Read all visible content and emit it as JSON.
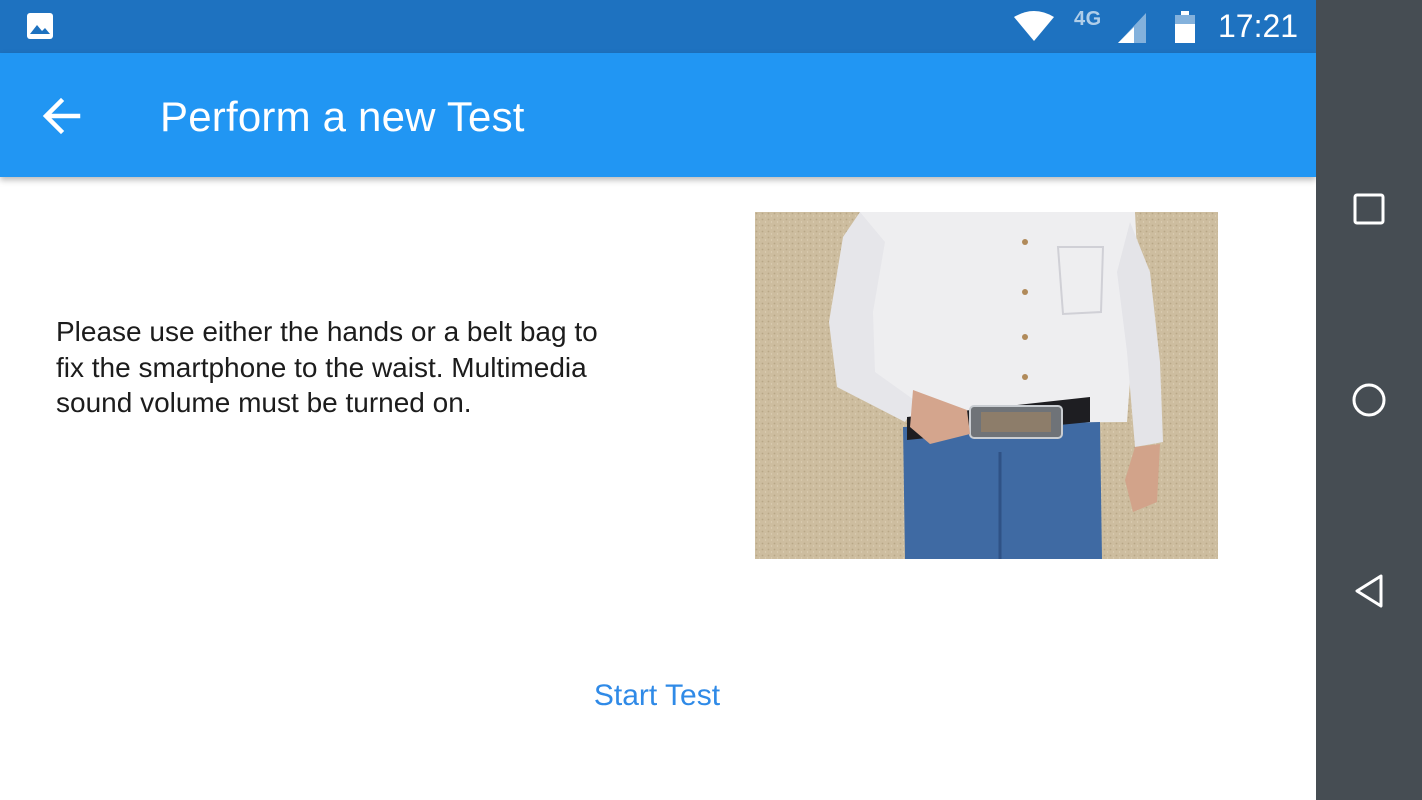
{
  "status_bar": {
    "time": "17:21",
    "network": "4G",
    "icons": [
      "image-notification-icon",
      "wifi-icon",
      "cell-signal-icon",
      "battery-icon"
    ]
  },
  "app_bar": {
    "title": "Perform a new Test",
    "back_icon": "arrow-back-icon"
  },
  "main": {
    "instruction": "Please use either the hands or a belt bag to fix the smartphone to the waist. Multimedia sound volume must be turned on.",
    "photo_description": "photo-man-belt-bag-phone",
    "start_button_label": "Start Test"
  },
  "nav_bar": {
    "icons": [
      "recents-square-icon",
      "home-circle-icon",
      "back-triangle-icon"
    ]
  },
  "colors": {
    "status_bar": "#1e72c0",
    "app_bar": "#2196f3",
    "accent_text": "#2f8ae7",
    "nav_bar": "#464d53"
  }
}
